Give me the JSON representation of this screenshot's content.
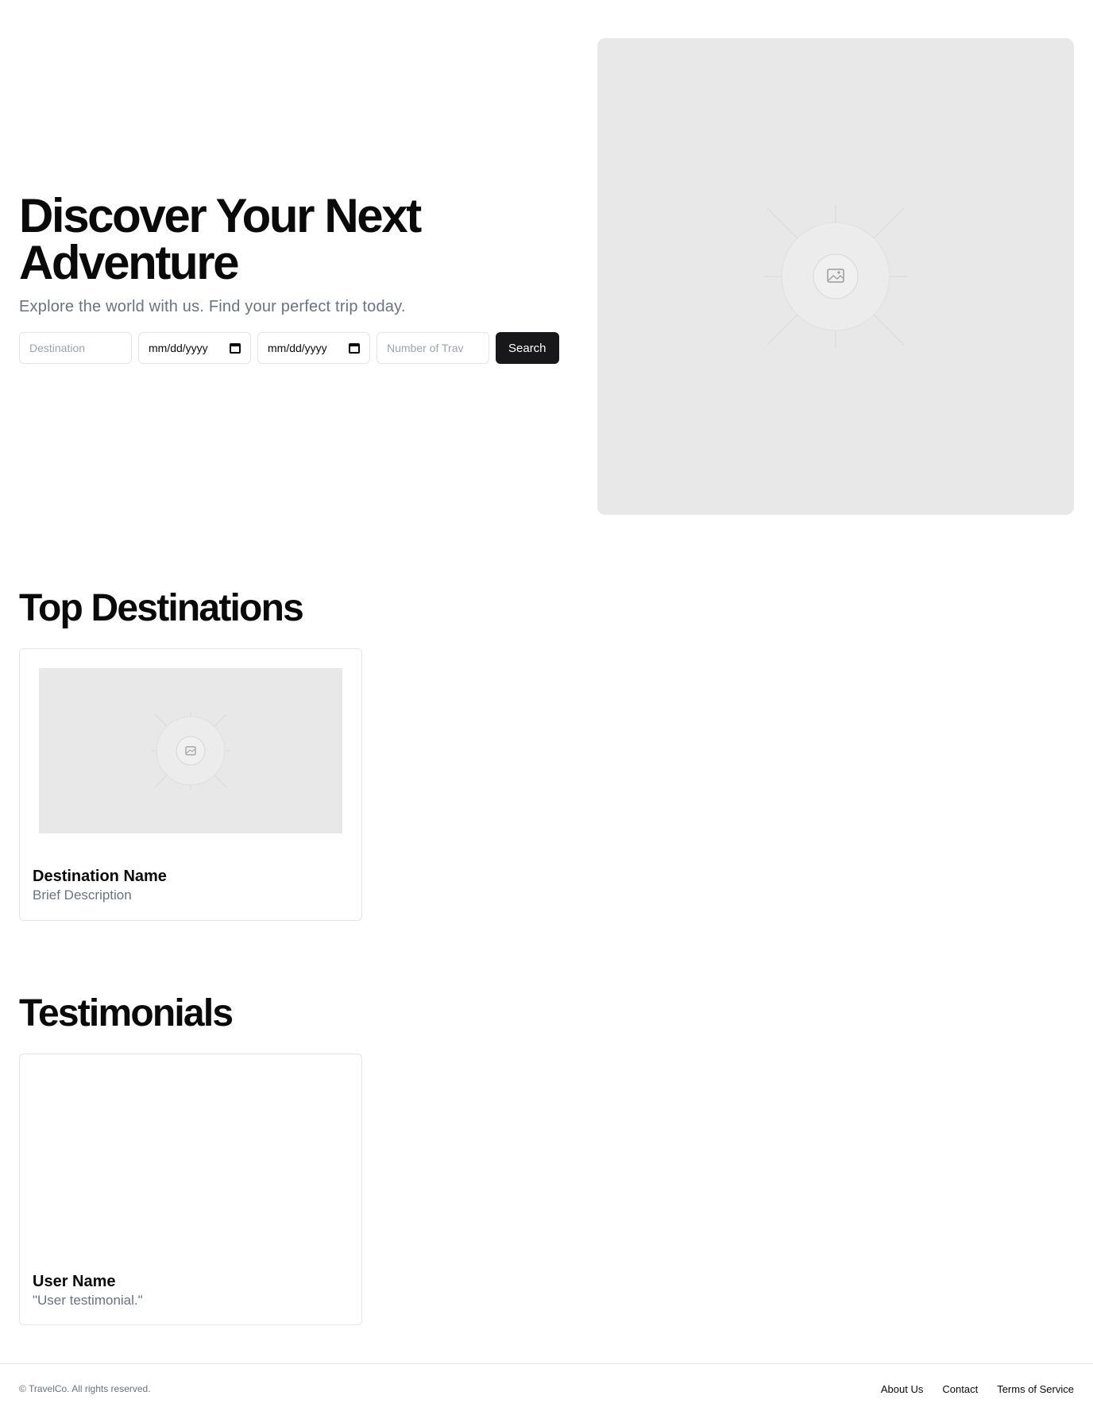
{
  "hero": {
    "title_line1": "Discover Your Next",
    "title_line2": "Adventure",
    "subtitle": "Explore the world with us. Find your perfect trip today.",
    "search": {
      "destination_placeholder": "Destination",
      "start_date_value": "mm/dd/yyyy",
      "end_date_value": "mm/dd/yyyy",
      "travelers_placeholder": "Number of Trav",
      "search_label": "Search"
    },
    "image_icon": "image-icon"
  },
  "destinations": {
    "title": "Top Destinations",
    "cards": [
      {
        "name": "Destination Name",
        "description": "Brief Description",
        "image_icon": "image-icon"
      }
    ]
  },
  "testimonials": {
    "title": "Testimonials",
    "cards": [
      {
        "name": "User Name",
        "quote": "\"User testimonial.\""
      }
    ]
  },
  "footer": {
    "copyright": "© TravelCo. All rights reserved.",
    "links": [
      "About Us",
      "Contact",
      "Terms of Service"
    ]
  },
  "colors": {
    "primary_button": "#18181b",
    "muted_text": "#6b7280",
    "placeholder_bg": "#e8e8e8",
    "border": "#e5e5e5"
  }
}
